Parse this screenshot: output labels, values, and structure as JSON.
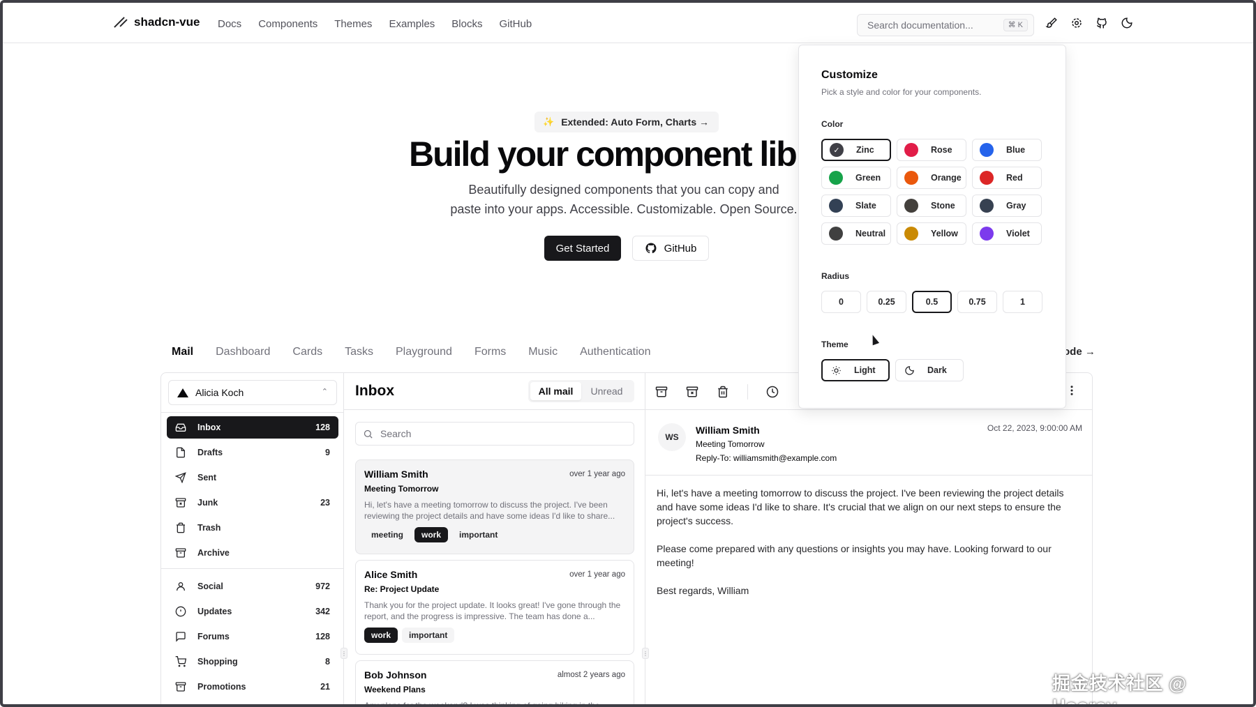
{
  "header": {
    "brand": "shadcn-vue",
    "nav": [
      "Docs",
      "Components",
      "Themes",
      "Examples",
      "Blocks",
      "GitHub"
    ],
    "search_placeholder": "Search documentation...",
    "search_kbd": "⌘ K",
    "icons": [
      "paintbrush-icon",
      "gear-icon",
      "github-icon",
      "theme-toggle-icon"
    ]
  },
  "hero": {
    "announcement": "Extended: Auto Form, Charts →",
    "title": "Build your component library",
    "subtitle_line1": "Beautifully designed components that you can copy and",
    "subtitle_line2": "paste into your apps. Accessible. Customizable. Open Source.",
    "primary_button": "Get Started",
    "secondary_button": "GitHub"
  },
  "examples": {
    "tabs": [
      "Mail",
      "Dashboard",
      "Cards",
      "Tasks",
      "Playground",
      "Forms",
      "Music",
      "Authentication"
    ],
    "active_tab": "Mail",
    "right_link": "ode →"
  },
  "mail": {
    "account": "Alicia Koch",
    "nav_primary": [
      {
        "label": "Inbox",
        "count": "128",
        "icon": "inbox-icon"
      },
      {
        "label": "Drafts",
        "count": "9",
        "icon": "file-icon"
      },
      {
        "label": "Sent",
        "count": "",
        "icon": "send-icon"
      },
      {
        "label": "Junk",
        "count": "23",
        "icon": "archive-x-icon"
      },
      {
        "label": "Trash",
        "count": "",
        "icon": "trash-icon"
      },
      {
        "label": "Archive",
        "count": "",
        "icon": "archive-icon"
      }
    ],
    "nav_secondary": [
      {
        "label": "Social",
        "count": "972",
        "icon": "user-icon"
      },
      {
        "label": "Updates",
        "count": "342",
        "icon": "alert-circle-icon"
      },
      {
        "label": "Forums",
        "count": "128",
        "icon": "message-square-icon"
      },
      {
        "label": "Shopping",
        "count": "8",
        "icon": "shopping-cart-icon"
      },
      {
        "label": "Promotions",
        "count": "21",
        "icon": "archive-icon"
      }
    ],
    "inbox_title": "Inbox",
    "filter_all": "All mail",
    "filter_unread": "Unread",
    "search_placeholder": "Search",
    "messages": [
      {
        "from": "William Smith",
        "when": "over 1 year ago",
        "subject": "Meeting Tomorrow",
        "body": "Hi, let's have a meeting tomorrow to discuss the project. I've been reviewing the project details and have some ideas I'd like to share...",
        "tags": [
          "meeting",
          "work",
          "important"
        ]
      },
      {
        "from": "Alice Smith",
        "when": "over 1 year ago",
        "subject": "Re: Project Update",
        "body": "Thank you for the project update. It looks great! I've gone through the report, and the progress is impressive. The team has done a...",
        "tags": [
          "work",
          "important"
        ]
      },
      {
        "from": "Bob Johnson",
        "when": "almost 2 years ago",
        "subject": "Weekend Plans",
        "body": "Any plans for the weekend? I was thinking of going hiking in the...",
        "tags": []
      }
    ],
    "reader": {
      "initials": "WS",
      "name": "William Smith",
      "subject": "Meeting Tomorrow",
      "reply_to": "Reply-To: williamsmith@example.com",
      "date": "Oct 22, 2023, 9:00:00 AM",
      "paragraphs": [
        "Hi, let's have a meeting tomorrow to discuss the project. I've been reviewing the project details and have some ideas I'd like to share. It's crucial that we align on our next steps to ensure the project's success.",
        "Please come prepared with any questions or insights you may have. Looking forward to our meeting!",
        "Best regards, William"
      ]
    }
  },
  "customize": {
    "title": "Customize",
    "subtitle": "Pick a style and color for your components.",
    "color_label": "Color",
    "colors": [
      {
        "name": "Zinc",
        "hex": "#3f3f46",
        "selected": true
      },
      {
        "name": "Rose",
        "hex": "#e11d48"
      },
      {
        "name": "Blue",
        "hex": "#2563eb"
      },
      {
        "name": "Green",
        "hex": "#16a34a"
      },
      {
        "name": "Orange",
        "hex": "#ea580c"
      },
      {
        "name": "Red",
        "hex": "#dc2626"
      },
      {
        "name": "Slate",
        "hex": "#334155"
      },
      {
        "name": "Stone",
        "hex": "#44403c"
      },
      {
        "name": "Gray",
        "hex": "#374151"
      },
      {
        "name": "Neutral",
        "hex": "#404040"
      },
      {
        "name": "Yellow",
        "hex": "#ca8a04"
      },
      {
        "name": "Violet",
        "hex": "#7c3aed"
      }
    ],
    "radius_label": "Radius",
    "radii": [
      "0",
      "0.25",
      "0.5",
      "0.75",
      "1"
    ],
    "radius_selected": "0.5",
    "theme_label": "Theme",
    "theme_light": "Light",
    "theme_dark": "Dark",
    "theme_selected": "Light"
  },
  "watermark": "掘金技术社区 @ Hooray"
}
